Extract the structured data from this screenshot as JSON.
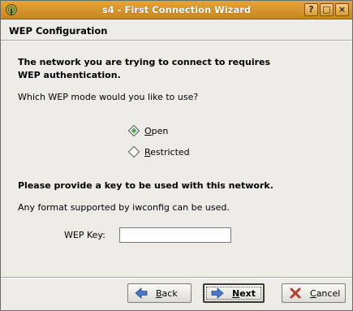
{
  "window": {
    "title": "s4 - First Connection Wizard"
  },
  "titlebar": {
    "help_glyph": "?",
    "maximize_glyph": "□",
    "close_glyph": "×",
    "icons": [
      "wifi-app-icon",
      "help-icon",
      "maximize-icon",
      "close-icon"
    ]
  },
  "header": {
    "title": "WEP Configuration"
  },
  "content": {
    "intro": "The network you are trying to connect to requires WEP authentication.",
    "question": "Which WEP mode would you like to use?",
    "modes": [
      {
        "label": "Open",
        "selected": true
      },
      {
        "label": "Restricted",
        "selected": false
      }
    ],
    "key_prompt": "Please provide a key to be used with this network.",
    "key_hint": "Any format supported by iwconfig can be used.",
    "key_label": "WEP Key:",
    "key_value": ""
  },
  "buttons": {
    "back": "Back",
    "next": "Next",
    "cancel": "Cancel"
  },
  "colors": {
    "titlebar": "#d69a34",
    "accent_green": "#5aa35a",
    "arrow_blue": "#4a78c8",
    "cancel_red": "#c0392b"
  }
}
